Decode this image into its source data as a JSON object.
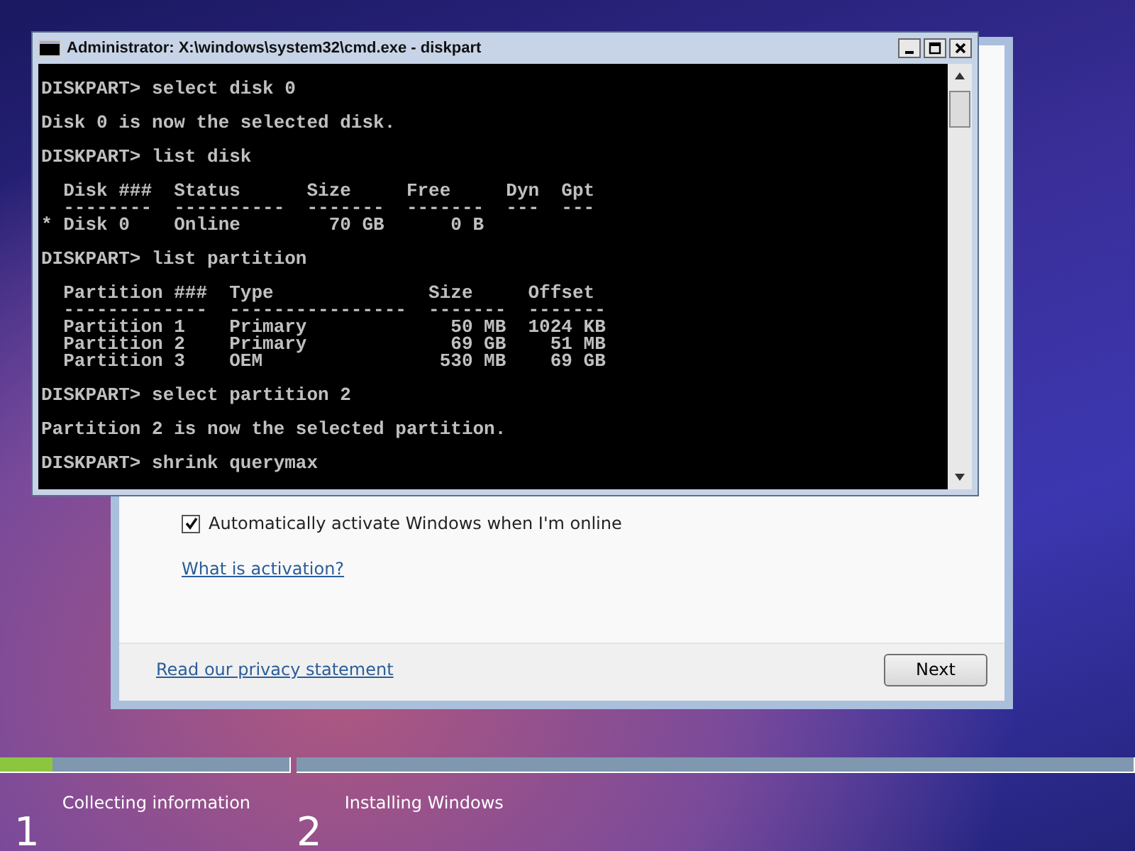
{
  "console_window": {
    "title": "Administrator: X:\\windows\\system32\\cmd.exe - diskpart",
    "blocks": [
      [
        "DISKPART> select disk 0"
      ],
      [
        "Disk 0 is now the selected disk."
      ],
      [
        "DISKPART> list disk"
      ],
      [
        "  Disk ###  Status      Size     Free     Dyn  Gpt",
        "  --------  ----------  -------  -------  ---  ---",
        "* Disk 0    Online        70 GB      0 B"
      ],
      [
        "DISKPART> list partition"
      ],
      [
        "  Partition ###  Type              Size     Offset",
        "  -------------  ----------------  -------  -------",
        "  Partition 1    Primary             50 MB  1024 KB",
        "  Partition 2    Primary             69 GB    51 MB",
        "  Partition 3    OEM                530 MB    69 GB"
      ],
      [
        "DISKPART> select partition 2"
      ],
      [
        "Partition 2 is now the selected partition."
      ],
      [
        "DISKPART> shrink querymax"
      ]
    ]
  },
  "setup_dialog": {
    "auto_activate": {
      "label": "Automatically activate Windows when I'm online",
      "checked": true
    },
    "activation_link": "What is activation?",
    "privacy_link": "Read our privacy statement",
    "next_button": "Next"
  },
  "steps": [
    {
      "number": "1",
      "label": "Collecting information",
      "level": 0.18
    },
    {
      "number": "2",
      "label": "Installing Windows",
      "level": 0
    }
  ]
}
